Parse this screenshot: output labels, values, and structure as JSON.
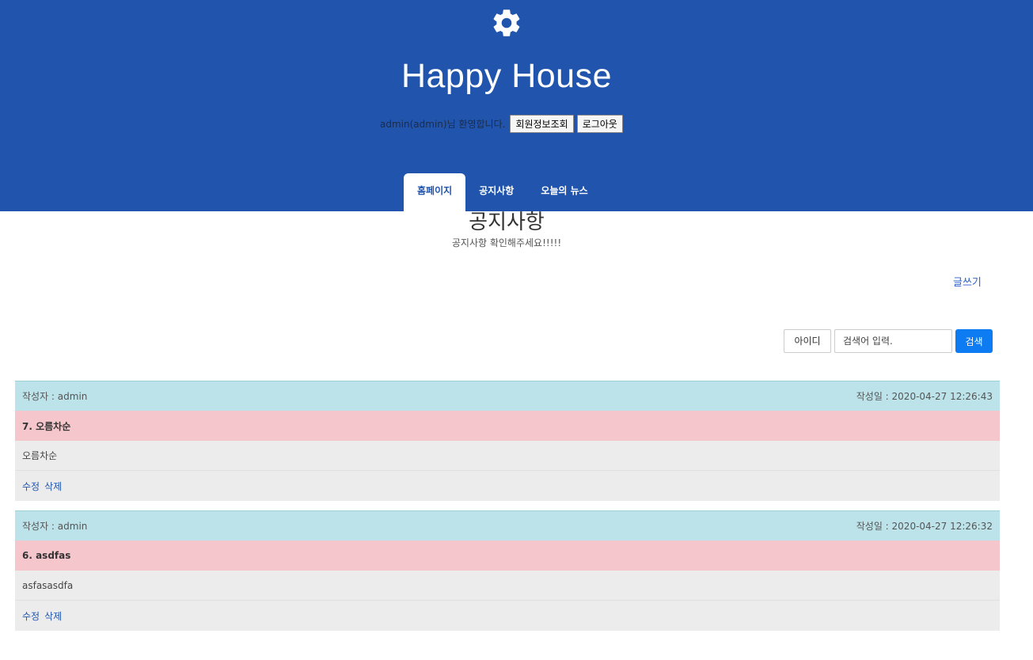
{
  "header": {
    "icon": "gear-icon",
    "site_title": "Happy House",
    "welcome_text": "admin(admin)님 환영합니다.",
    "member_info_label": "회원정보조회",
    "logout_label": "로그아웃"
  },
  "nav": {
    "tabs": [
      {
        "label": "홈페이지",
        "active": true
      },
      {
        "label": "공지사항",
        "active": false
      },
      {
        "label": "오늘의 뉴스",
        "active": false
      }
    ]
  },
  "page": {
    "heading": "공지사항",
    "subheading": "공지사항 확인해주세요!!!!!",
    "write_label": "글쓰기"
  },
  "search": {
    "field_option": "아이디",
    "placeholder": "검색어 입력.",
    "button_label": "검색"
  },
  "posts": [
    {
      "author_label": "작성자 : admin",
      "date_label": "작성일 : 2020-04-27 12:26:43",
      "subject": "7. 오름차순",
      "body": "오름차순",
      "edit_label": "수정",
      "delete_label": "삭제"
    },
    {
      "author_label": "작성자 : admin",
      "date_label": "작성일 : 2020-04-27 12:26:32",
      "subject": "6. asdfas",
      "body": "asfasasdfa",
      "edit_label": "수정",
      "delete_label": "삭제"
    }
  ],
  "colors": {
    "header_bg": "#2155ad",
    "meta_bg": "#bde3ea",
    "subject_bg": "#f5c6cc",
    "body_bg": "#ececec",
    "primary_button": "#0d7bf2"
  }
}
